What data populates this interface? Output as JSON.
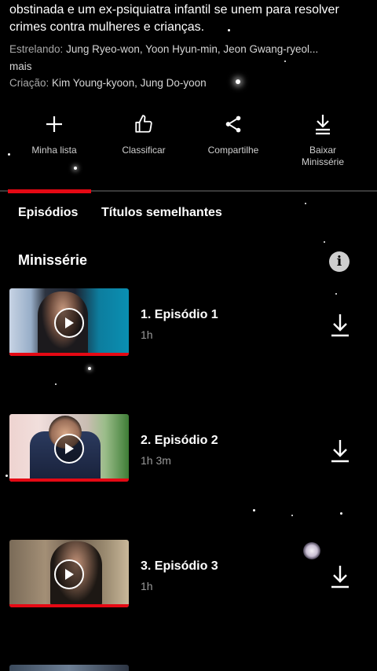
{
  "synopsis_tail": "obstinada e um ex-psiquiatra infantil se unem para resolver crimes contra mulheres e crianças.",
  "cast": {
    "label": "Estrelando:",
    "names": "Jung Ryeo-won, Yoon Hyun-min, Jeon Gwang-ryeol...",
    "more": "mais"
  },
  "creators": {
    "label": "Criação:",
    "names": "Kim Young-kyoon, Jung Do-yoon"
  },
  "actions": [
    {
      "label": "Minha lista",
      "icon": "plus-icon"
    },
    {
      "label": "Classificar",
      "icon": "thumbs-up-icon"
    },
    {
      "label": "Compartilhe",
      "icon": "share-icon"
    },
    {
      "label": "Baixar Minissérie",
      "icon": "download-icon"
    }
  ],
  "tabs": [
    {
      "label": "Episódios",
      "active": true
    },
    {
      "label": "Títulos semelhantes",
      "active": false
    }
  ],
  "section": {
    "title": "Minissérie",
    "info_icon": "info-icon"
  },
  "episodes": [
    {
      "title": "1. Episódio 1",
      "duration": "1h",
      "progress": 1.0
    },
    {
      "title": "2. Episódio 2",
      "duration": "1h 3m",
      "progress": 1.0
    },
    {
      "title": "3. Episódio 3",
      "duration": "1h",
      "progress": 1.0
    }
  ],
  "colors": {
    "accent": "#e50914",
    "background": "#000000",
    "secondary_text": "#9a9a9a"
  }
}
